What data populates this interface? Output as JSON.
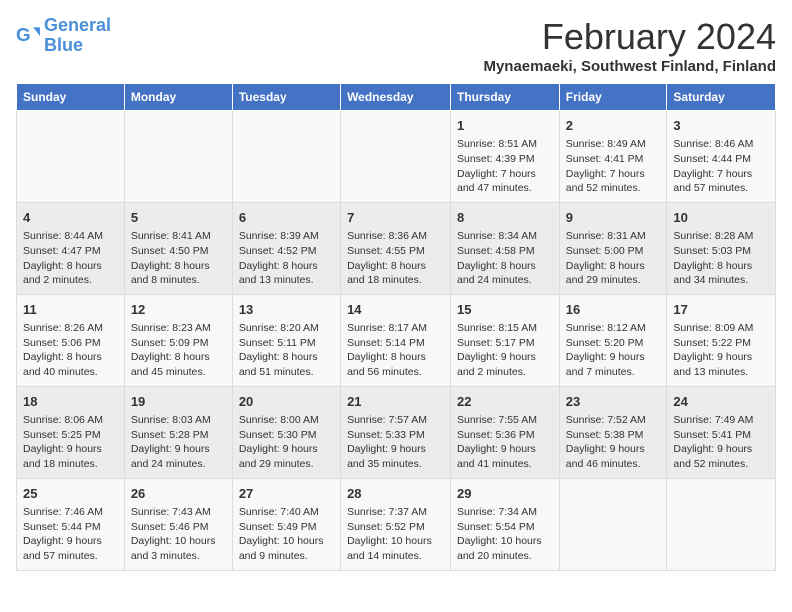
{
  "header": {
    "logo_line1": "General",
    "logo_line2": "Blue",
    "month": "February 2024",
    "location": "Mynaemaeki, Southwest Finland, Finland"
  },
  "weekdays": [
    "Sunday",
    "Monday",
    "Tuesday",
    "Wednesday",
    "Thursday",
    "Friday",
    "Saturday"
  ],
  "weeks": [
    [
      {
        "day": "",
        "info": ""
      },
      {
        "day": "",
        "info": ""
      },
      {
        "day": "",
        "info": ""
      },
      {
        "day": "",
        "info": ""
      },
      {
        "day": "1",
        "info": "Sunrise: 8:51 AM\nSunset: 4:39 PM\nDaylight: 7 hours\nand 47 minutes."
      },
      {
        "day": "2",
        "info": "Sunrise: 8:49 AM\nSunset: 4:41 PM\nDaylight: 7 hours\nand 52 minutes."
      },
      {
        "day": "3",
        "info": "Sunrise: 8:46 AM\nSunset: 4:44 PM\nDaylight: 7 hours\nand 57 minutes."
      }
    ],
    [
      {
        "day": "4",
        "info": "Sunrise: 8:44 AM\nSunset: 4:47 PM\nDaylight: 8 hours\nand 2 minutes."
      },
      {
        "day": "5",
        "info": "Sunrise: 8:41 AM\nSunset: 4:50 PM\nDaylight: 8 hours\nand 8 minutes."
      },
      {
        "day": "6",
        "info": "Sunrise: 8:39 AM\nSunset: 4:52 PM\nDaylight: 8 hours\nand 13 minutes."
      },
      {
        "day": "7",
        "info": "Sunrise: 8:36 AM\nSunset: 4:55 PM\nDaylight: 8 hours\nand 18 minutes."
      },
      {
        "day": "8",
        "info": "Sunrise: 8:34 AM\nSunset: 4:58 PM\nDaylight: 8 hours\nand 24 minutes."
      },
      {
        "day": "9",
        "info": "Sunrise: 8:31 AM\nSunset: 5:00 PM\nDaylight: 8 hours\nand 29 minutes."
      },
      {
        "day": "10",
        "info": "Sunrise: 8:28 AM\nSunset: 5:03 PM\nDaylight: 8 hours\nand 34 minutes."
      }
    ],
    [
      {
        "day": "11",
        "info": "Sunrise: 8:26 AM\nSunset: 5:06 PM\nDaylight: 8 hours\nand 40 minutes."
      },
      {
        "day": "12",
        "info": "Sunrise: 8:23 AM\nSunset: 5:09 PM\nDaylight: 8 hours\nand 45 minutes."
      },
      {
        "day": "13",
        "info": "Sunrise: 8:20 AM\nSunset: 5:11 PM\nDaylight: 8 hours\nand 51 minutes."
      },
      {
        "day": "14",
        "info": "Sunrise: 8:17 AM\nSunset: 5:14 PM\nDaylight: 8 hours\nand 56 minutes."
      },
      {
        "day": "15",
        "info": "Sunrise: 8:15 AM\nSunset: 5:17 PM\nDaylight: 9 hours\nand 2 minutes."
      },
      {
        "day": "16",
        "info": "Sunrise: 8:12 AM\nSunset: 5:20 PM\nDaylight: 9 hours\nand 7 minutes."
      },
      {
        "day": "17",
        "info": "Sunrise: 8:09 AM\nSunset: 5:22 PM\nDaylight: 9 hours\nand 13 minutes."
      }
    ],
    [
      {
        "day": "18",
        "info": "Sunrise: 8:06 AM\nSunset: 5:25 PM\nDaylight: 9 hours\nand 18 minutes."
      },
      {
        "day": "19",
        "info": "Sunrise: 8:03 AM\nSunset: 5:28 PM\nDaylight: 9 hours\nand 24 minutes."
      },
      {
        "day": "20",
        "info": "Sunrise: 8:00 AM\nSunset: 5:30 PM\nDaylight: 9 hours\nand 29 minutes."
      },
      {
        "day": "21",
        "info": "Sunrise: 7:57 AM\nSunset: 5:33 PM\nDaylight: 9 hours\nand 35 minutes."
      },
      {
        "day": "22",
        "info": "Sunrise: 7:55 AM\nSunset: 5:36 PM\nDaylight: 9 hours\nand 41 minutes."
      },
      {
        "day": "23",
        "info": "Sunrise: 7:52 AM\nSunset: 5:38 PM\nDaylight: 9 hours\nand 46 minutes."
      },
      {
        "day": "24",
        "info": "Sunrise: 7:49 AM\nSunset: 5:41 PM\nDaylight: 9 hours\nand 52 minutes."
      }
    ],
    [
      {
        "day": "25",
        "info": "Sunrise: 7:46 AM\nSunset: 5:44 PM\nDaylight: 9 hours\nand 57 minutes."
      },
      {
        "day": "26",
        "info": "Sunrise: 7:43 AM\nSunset: 5:46 PM\nDaylight: 10 hours\nand 3 minutes."
      },
      {
        "day": "27",
        "info": "Sunrise: 7:40 AM\nSunset: 5:49 PM\nDaylight: 10 hours\nand 9 minutes."
      },
      {
        "day": "28",
        "info": "Sunrise: 7:37 AM\nSunset: 5:52 PM\nDaylight: 10 hours\nand 14 minutes."
      },
      {
        "day": "29",
        "info": "Sunrise: 7:34 AM\nSunset: 5:54 PM\nDaylight: 10 hours\nand 20 minutes."
      },
      {
        "day": "",
        "info": ""
      },
      {
        "day": "",
        "info": ""
      }
    ]
  ]
}
